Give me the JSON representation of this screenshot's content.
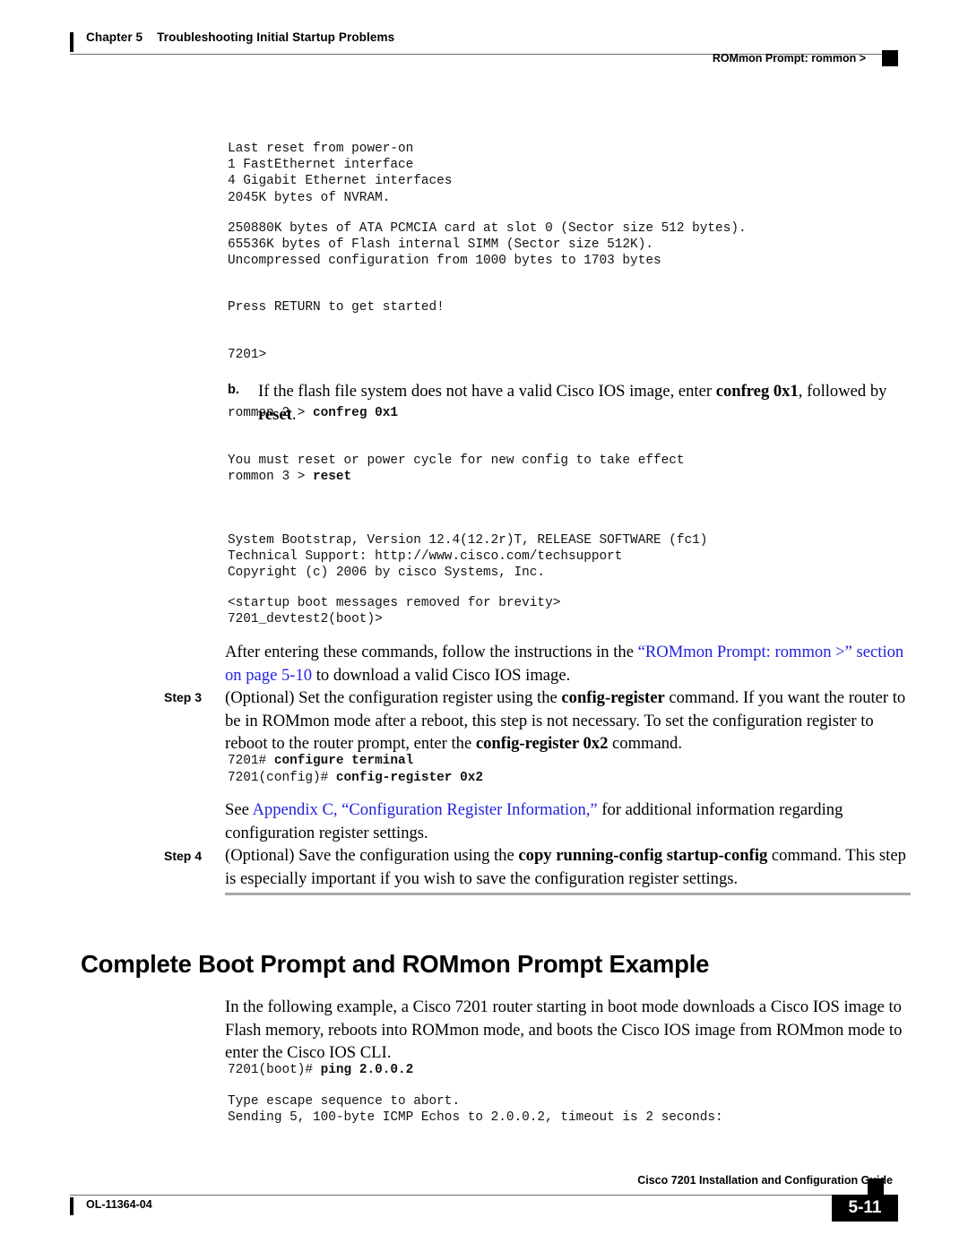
{
  "header": {
    "chapter_number": "Chapter 5",
    "chapter_title": "Troubleshooting Initial Startup Problems",
    "running_head": "ROMmon Prompt: rommon >"
  },
  "console_output_1": {
    "lines": "Last reset from power-on\n1 FastEthernet interface\n4 Gigabit Ethernet interfaces\n2045K bytes of NVRAM."
  },
  "console_output_2": {
    "lines": "250880K bytes of ATA PCMCIA card at slot 0 (Sector size 512 bytes).\n65536K bytes of Flash internal SIMM (Sector size 512K).\nUncompressed configuration from 1000 bytes to 1703 bytes"
  },
  "console_output_3": {
    "lines": "Press RETURN to get started!"
  },
  "console_output_4": {
    "lines": "7201>"
  },
  "substep_b": {
    "marker": "b.",
    "text_1": "If the flash file system does not have a valid Cisco IOS image, enter ",
    "bold_1": "confreg 0x1",
    "text_2": ", followed by ",
    "bold_2": "reset",
    "text_3": "."
  },
  "cmd_confreg": {
    "prompt": "rommon 2 > ",
    "command": "confreg 0x1"
  },
  "console_output_5": {
    "lines": "You must reset or power cycle for new config to take effect"
  },
  "cmd_reset": {
    "prompt": "rommon 3 > ",
    "command": "reset"
  },
  "console_output_6": {
    "lines": "System Bootstrap, Version 12.4(12.2r)T, RELEASE SOFTWARE (fc1)\nTechnical Support: http://www.cisco.com/techsupport\nCopyright (c) 2006 by cisco Systems, Inc."
  },
  "console_output_7": {
    "lines": "<startup boot messages removed for brevity>\n7201_devtest2(boot)>"
  },
  "after_commands_para": {
    "text_1": "After entering these commands, follow the instructions in the ",
    "link_1": "“ROMmon Prompt: rommon >” section on page 5-10",
    "text_2": " to download a valid Cisco IOS image."
  },
  "step_3": {
    "label": "Step 3",
    "text_1": "(Optional) Set the configuration register using the ",
    "bold_1": "config-register",
    "text_2": " command. If you want the router to be in ROMmon mode after a reboot, this step is not necessary. To set the configuration register to reboot to the router prompt, enter the ",
    "bold_2": "config-register 0x2",
    "text_3": " command."
  },
  "cmd_configure_terminal": {
    "prompt": "7201# ",
    "command": "configure terminal"
  },
  "cmd_config_register": {
    "prompt": "7201(config)# ",
    "command": "config-register 0x2"
  },
  "see_appendix_para": {
    "text_1": "See ",
    "link_1": "Appendix C, “Configuration Register Information,”",
    "text_2": " for additional information regarding configuration register settings."
  },
  "step_4": {
    "label": "Step 4",
    "text_1": "(Optional) Save the configuration using the ",
    "bold_1": "copy running-config startup-config",
    "text_2": " command. This step is especially important if you wish to save the configuration register settings."
  },
  "section": {
    "heading": "Complete Boot Prompt and ROMmon Prompt Example",
    "intro_para": "In the following example, a Cisco 7201 router starting in boot mode downloads a Cisco IOS image to Flash memory, reboots into ROMmon mode, and boots the Cisco IOS image from ROMmon mode to enter the Cisco IOS CLI."
  },
  "cmd_ping": {
    "prompt": "7201(boot)# ",
    "command": "ping 2.0.0.2"
  },
  "console_output_8": {
    "lines": "Type escape sequence to abort.\nSending 5, 100-byte ICMP Echos to 2.0.0.2, timeout is 2 seconds:"
  },
  "footer": {
    "guide_title": "Cisco 7201 Installation and Configuration Guide",
    "doc_id": "OL-11364-04",
    "page_number": "5-11"
  }
}
